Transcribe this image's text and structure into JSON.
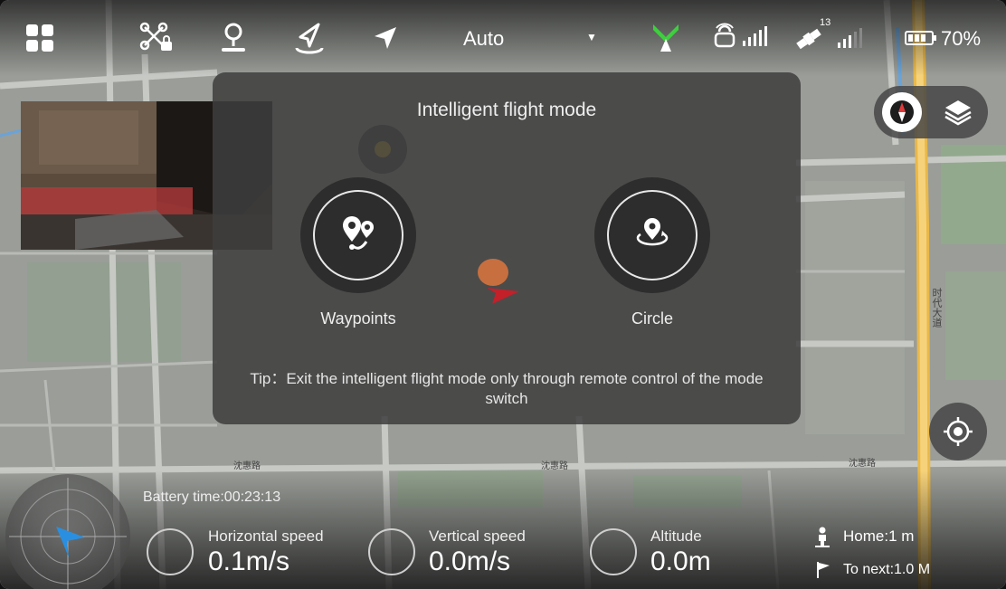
{
  "topbar": {
    "icons": [
      "grid-menu-icon",
      "drone-lock-icon",
      "map-pin-icon",
      "takeoff-icon",
      "navigation-arrow-icon",
      "drone-status-icon",
      "remote-signal-icon",
      "satellite-icon",
      "battery-icon"
    ],
    "flight_mode": "Auto",
    "satellite_count": "13",
    "battery_percent": "70%"
  },
  "modal": {
    "title": "Intelligent flight mode",
    "options": [
      {
        "label": "Waypoints",
        "icon": "waypoints-icon"
      },
      {
        "label": "Circle",
        "icon": "circle-orbit-icon"
      }
    ],
    "tip": "Tip：Exit the intelligent flight mode only through remote control of the mode switch"
  },
  "map_controls": {
    "icons": [
      "compass-icon",
      "layers-icon",
      "locate-icon"
    ]
  },
  "telemetry": {
    "battery_time": "Battery time:00:23:13",
    "horizontal_speed_label": "Horizontal speed",
    "horizontal_speed_value": "0.1m/s",
    "vertical_speed_label": "Vertical speed",
    "vertical_speed_value": "0.0m/s",
    "altitude_label": "Altitude",
    "altitude_value": "0.0m",
    "home_distance": "Home:1 m",
    "next_distance": "To next:1.0 M"
  },
  "map_labels": {
    "road_1": "沈惠路",
    "road_2": "沈惠路",
    "road_3": "时代大道",
    "road_4": "沈惠路"
  },
  "colors": {
    "signal_green": "#3ecf3e",
    "modal_bg": "#3e3e3e",
    "drone_blue": "#2a8fe0",
    "road_yellow": "#f1c85a"
  }
}
